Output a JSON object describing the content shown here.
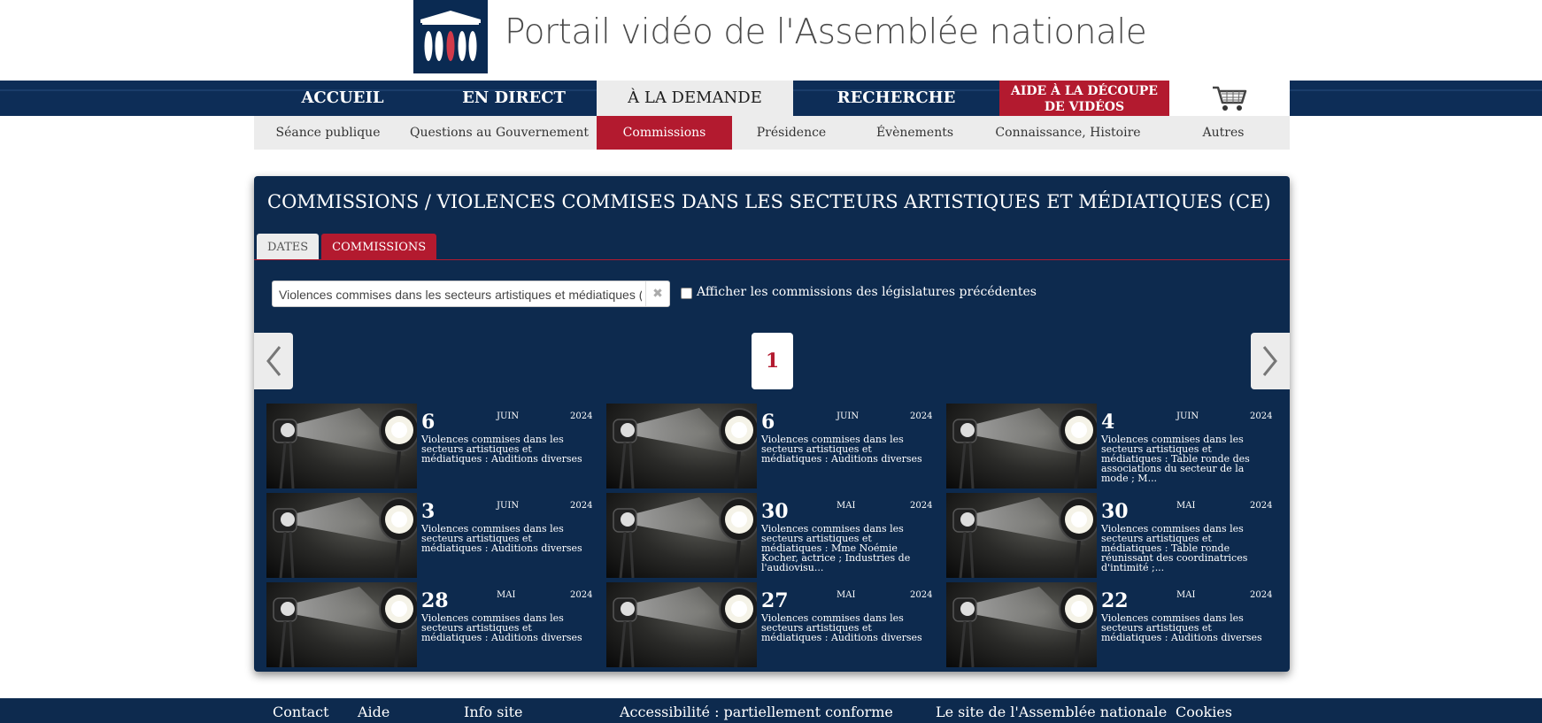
{
  "site": {
    "title": "Portail vidéo de l'Assemblée nationale"
  },
  "mainnav": [
    {
      "label": "ACCUEIL"
    },
    {
      "label": "EN DIRECT"
    },
    {
      "label": "À LA DEMANDE"
    },
    {
      "label": "RECHERCHE"
    },
    {
      "label_line1": "AIDE À LA DÉCOUPE",
      "label_line2": "DE VIDÉOS"
    },
    {
      "icon": "cart-icon"
    }
  ],
  "subnav": [
    {
      "label": "Séance publique"
    },
    {
      "label": "Questions au Gouvernement"
    },
    {
      "label": "Commissions"
    },
    {
      "label": "Présidence"
    },
    {
      "label": "Évènements"
    },
    {
      "label": "Connaissance, Histoire"
    },
    {
      "label": "Autres"
    }
  ],
  "panel": {
    "title": "COMMISSIONS / VIOLENCES COMMISES DANS LES SECTEURS ARTISTIQUES ET MÉDIATIQUES (CE)",
    "tabs": [
      {
        "label": "DATES"
      },
      {
        "label": "COMMISSIONS"
      }
    ],
    "select_value": "Violences commises dans les secteurs artistiques et médiatiques (CE)",
    "checkbox_label": "Afficher les commissions des législatures précédentes",
    "page": "1"
  },
  "videos": [
    {
      "day": "6",
      "month": "JUIN",
      "year": "2024",
      "title": "Violences commises dans les secteurs artistiques et médiatiques : Auditions diverses"
    },
    {
      "day": "6",
      "month": "JUIN",
      "year": "2024",
      "title": "Violences commises dans les secteurs artistiques et médiatiques : Auditions diverses"
    },
    {
      "day": "4",
      "month": "JUIN",
      "year": "2024",
      "title": "Violences commises dans les secteurs artistiques et médiatiques : Table ronde des associations du secteur de la mode ; M..."
    },
    {
      "day": "3",
      "month": "JUIN",
      "year": "2024",
      "title": "Violences commises dans les secteurs artistiques et médiatiques : Auditions diverses"
    },
    {
      "day": "30",
      "month": "MAI",
      "year": "2024",
      "title": "Violences commises dans les secteurs artistiques et médiatiques : Mme Noémie Kocher, actrice ; Industries de l'audiovisu..."
    },
    {
      "day": "30",
      "month": "MAI",
      "year": "2024",
      "title": "Violences commises dans les secteurs artistiques et médiatiques : Table ronde réunissant des coordinatrices d'intimité ;..."
    },
    {
      "day": "28",
      "month": "MAI",
      "year": "2024",
      "title": "Violences commises dans les secteurs artistiques et médiatiques : Auditions diverses"
    },
    {
      "day": "27",
      "month": "MAI",
      "year": "2024",
      "title": "Violences commises dans les secteurs artistiques et médiatiques : Auditions diverses"
    },
    {
      "day": "22",
      "month": "MAI",
      "year": "2024",
      "title": "Violences commises dans les secteurs artistiques et médiatiques : Auditions diverses"
    }
  ],
  "footer": [
    {
      "label": "Contact"
    },
    {
      "label": "Aide"
    },
    {
      "label": "Info site"
    },
    {
      "label": "Accessibilité : partiellement conforme"
    },
    {
      "label": "Le site de l'Assemblée nationale"
    },
    {
      "label": "Cookies"
    }
  ],
  "colors": {
    "navy": "#0d2a4e",
    "red": "#b31a2f",
    "light": "#ececec"
  }
}
